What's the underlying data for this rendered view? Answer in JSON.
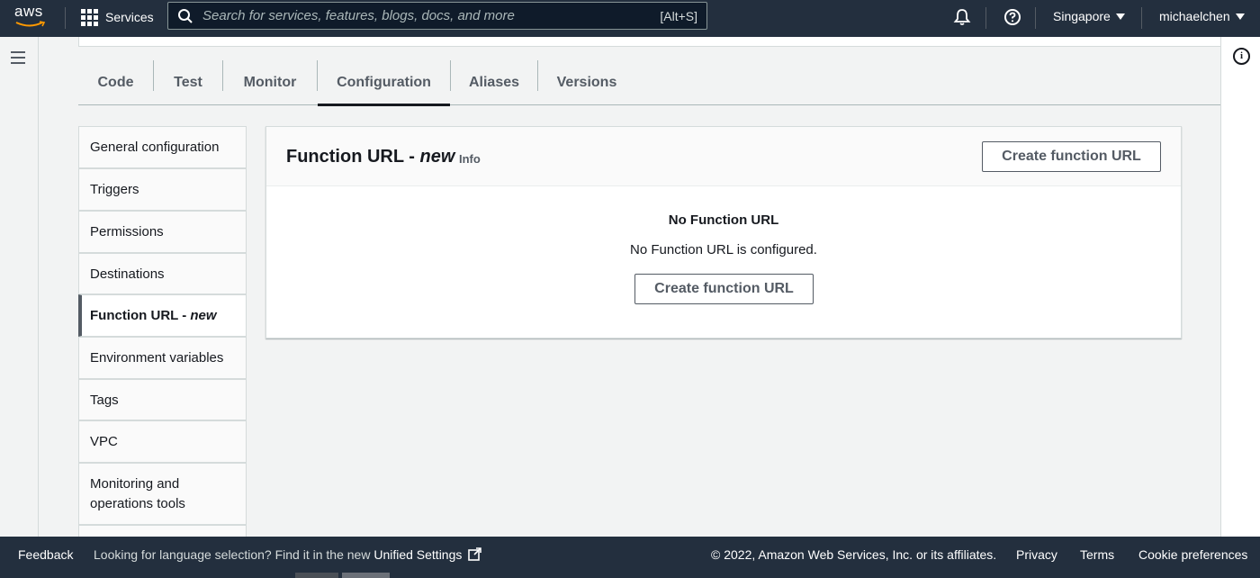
{
  "topnav": {
    "logo_text": "aws",
    "services_label": "Services",
    "search_placeholder": "Search for services, features, blogs, docs, and more",
    "search_shortcut": "[Alt+S]",
    "region": "Singapore",
    "user": "michaelchen",
    "bg_color": "#232f3e"
  },
  "tabs": [
    {
      "label": "Code",
      "active": false
    },
    {
      "label": "Test",
      "active": false
    },
    {
      "label": "Monitor",
      "active": false
    },
    {
      "label": "Configuration",
      "active": true
    },
    {
      "label": "Aliases",
      "active": false
    },
    {
      "label": "Versions",
      "active": false
    }
  ],
  "sidenav": {
    "items": [
      {
        "label": "General configuration"
      },
      {
        "label": "Triggers"
      },
      {
        "label": "Permissions"
      },
      {
        "label": "Destinations"
      },
      {
        "label": "Function URL - ",
        "suffix": "new",
        "active": true
      },
      {
        "label": "Environment variables"
      },
      {
        "label": "Tags"
      },
      {
        "label": "VPC"
      },
      {
        "label": "Monitoring and operations tools"
      }
    ]
  },
  "panel": {
    "title": "Function URL - ",
    "title_suffix": "new",
    "info": "Info",
    "header_button": "Create function URL",
    "empty_title": "No Function URL",
    "empty_description": "No Function URL is configured.",
    "empty_button": "Create function URL"
  },
  "footer": {
    "feedback": "Feedback",
    "language_note": "Looking for language selection? Find it in the new ",
    "unified_settings": "Unified Settings",
    "copyright": "© 2022, Amazon Web Services, Inc. or its affiliates.",
    "privacy": "Privacy",
    "terms": "Terms",
    "cookie": "Cookie preferences"
  },
  "icons": [
    "aws-logo",
    "services-grid-icon",
    "search-icon",
    "bell-icon",
    "help-icon",
    "hamburger-icon",
    "info-icon",
    "external-link-icon"
  ]
}
